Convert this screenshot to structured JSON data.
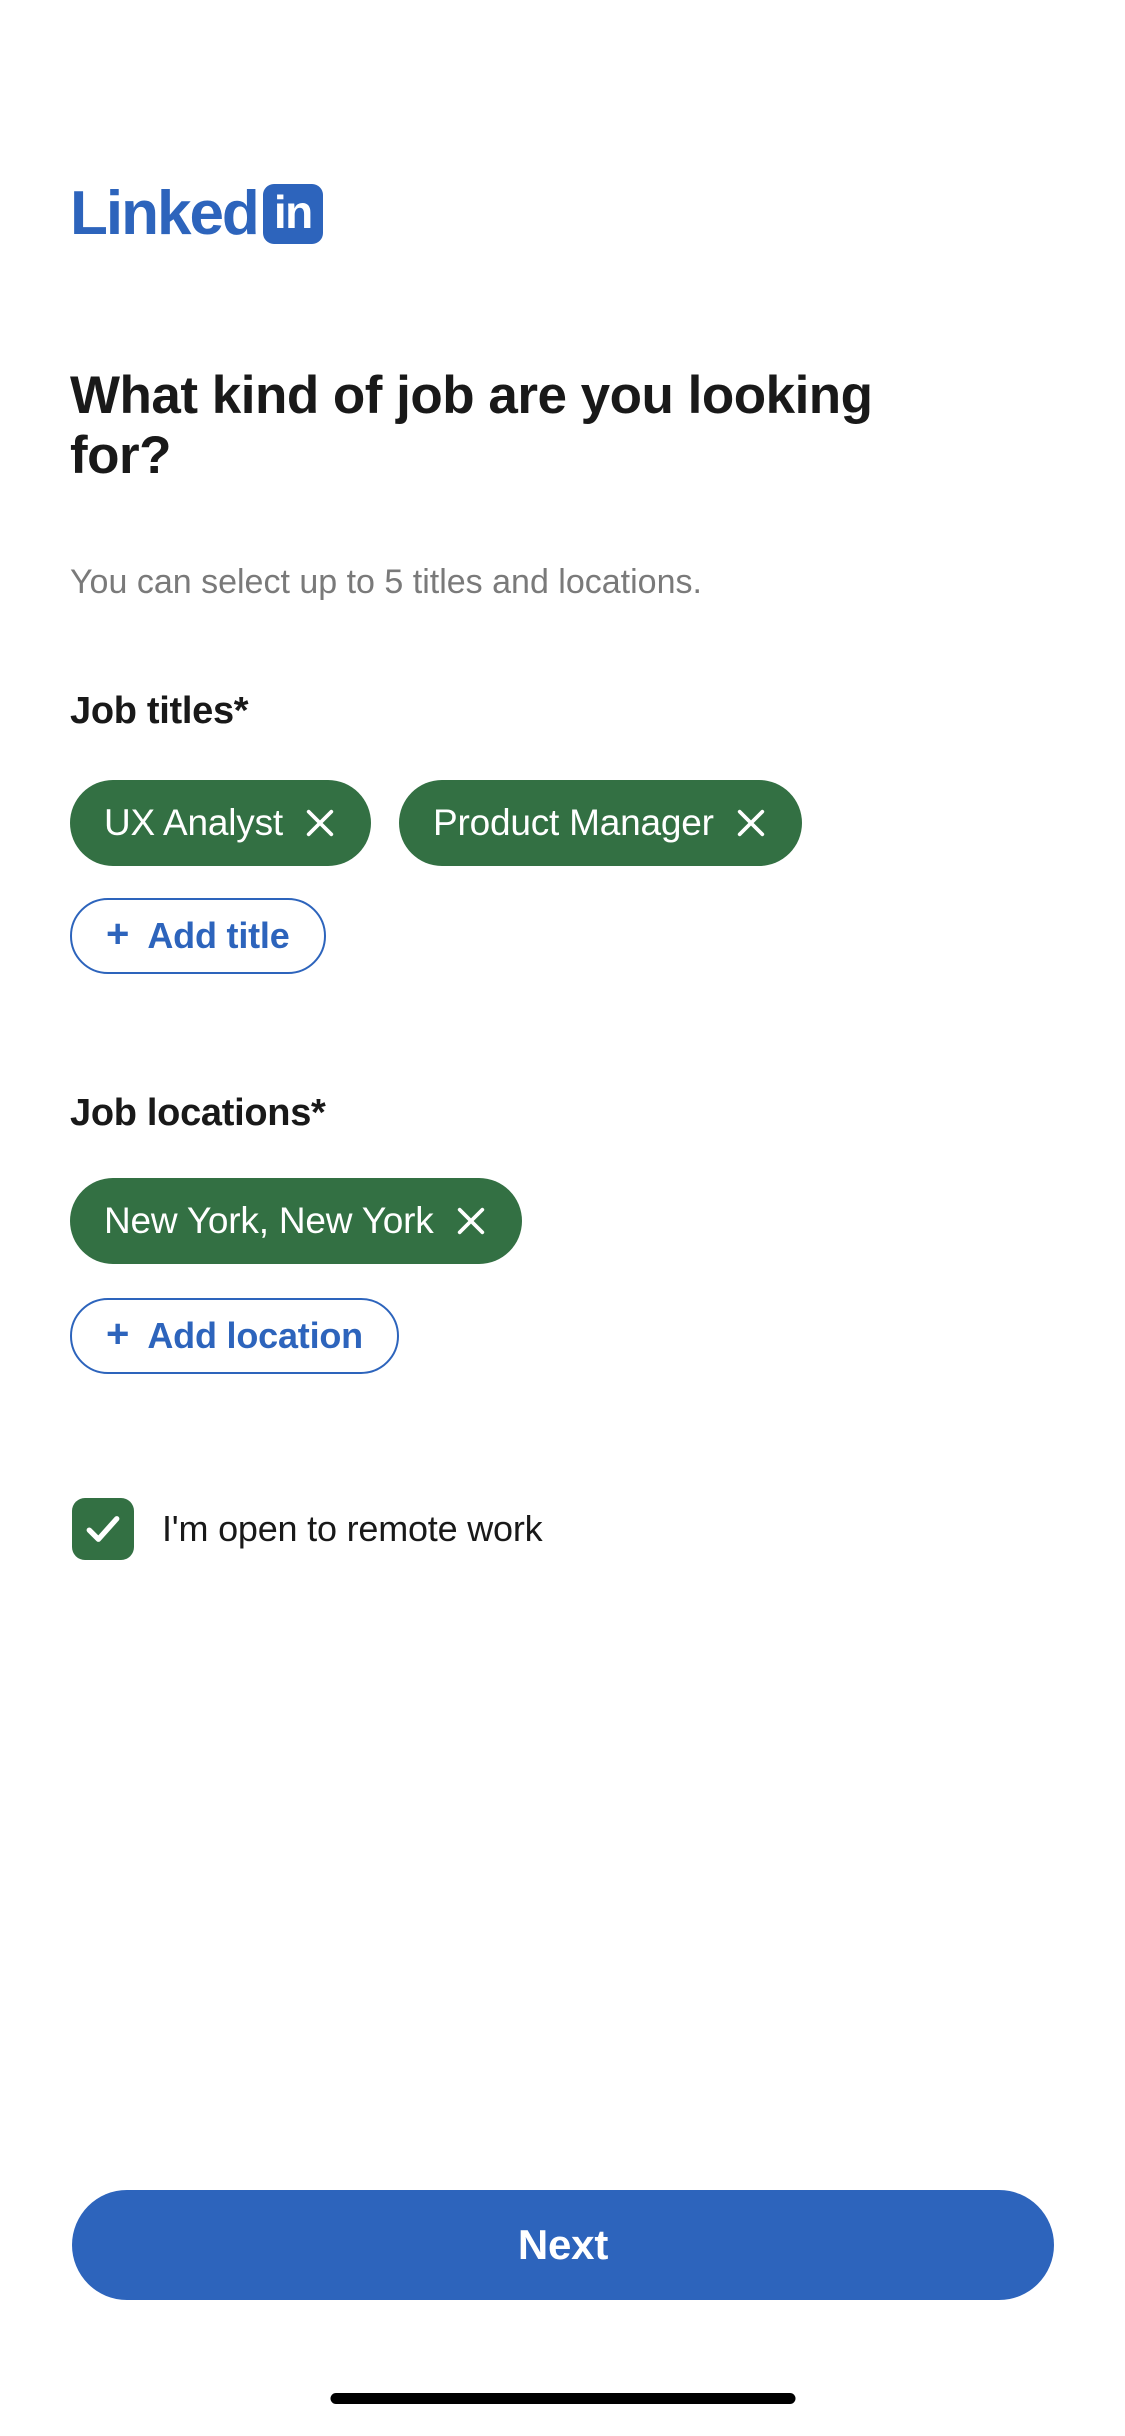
{
  "brand": {
    "logo_word": "Linked",
    "logo_badge": "in",
    "blue": "#2D64BC",
    "green": "#337043"
  },
  "header": {
    "heading": "What kind of job are you looking for?",
    "subtitle": "You can select up to 5 titles and locations."
  },
  "job_titles": {
    "label": "Job titles*",
    "chips": [
      {
        "label": "UX Analyst",
        "remove_icon": "close-icon"
      },
      {
        "label": "Product Manager",
        "remove_icon": "close-icon"
      }
    ],
    "add_button": {
      "plus": "+",
      "label": "Add title",
      "icon": "plus-icon"
    }
  },
  "job_locations": {
    "label": "Job locations*",
    "chips": [
      {
        "label": "New York, New York",
        "remove_icon": "close-icon"
      }
    ],
    "add_button": {
      "plus": "+",
      "label": "Add location",
      "icon": "plus-icon"
    }
  },
  "remote_option": {
    "label": "I'm open to remote work",
    "checked": true,
    "icon": "checkmark-icon"
  },
  "footer": {
    "next_label": "Next"
  }
}
